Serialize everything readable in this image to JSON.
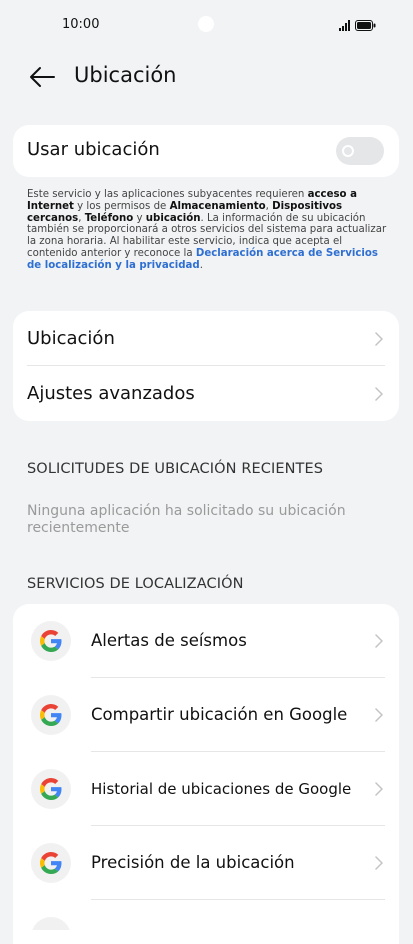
{
  "status_bar": {
    "time": "10:00"
  },
  "header": {
    "title": "Ubicación"
  },
  "use_location": {
    "label": "Usar ubicación",
    "enabled": false
  },
  "description": {
    "t1": "Este servicio y las aplicaciones subyacentes requieren ",
    "b1": "acceso a Internet",
    "t2": " y los permisos de ",
    "b2": "Almacenamiento",
    "t3": ", ",
    "b3": "Dispositivos cercanos",
    "t4": ", ",
    "b4": "Teléfono",
    "t5": " y ",
    "b5": "ubicación",
    "t6": ". La información de su ubicación también se proporcionará a otros servicios del sistema para actualizar la zona horaria. Al habilitar este servicio, indica que acepta el contenido anterior y reconoce la ",
    "link": "Declaración acerca de Servicios de localización y la privacidad",
    "t7": "."
  },
  "settings": {
    "items": [
      {
        "label": "Ubicación"
      },
      {
        "label": "Ajustes avanzados"
      }
    ]
  },
  "recent": {
    "header": "SOLICITUDES DE UBICACIÓN RECIENTES",
    "empty": "Ninguna aplicación ha solicitado su ubicación recientemente"
  },
  "services": {
    "header": "SERVICIOS DE LOCALIZACIÓN",
    "items": [
      {
        "label": "Alertas de seísmos",
        "icon": "google-icon"
      },
      {
        "label": "Compartir ubicación en Google",
        "icon": "google-icon"
      },
      {
        "label": "Historial de ubicaciones de Google",
        "icon": "google-icon"
      },
      {
        "label": "Precisión de la ubicación",
        "icon": "google-icon"
      }
    ]
  },
  "colors": {
    "background": "#f1f3f5",
    "card": "#ffffff",
    "link": "#2f6fd1",
    "toggle_off": "#e4e6e8"
  }
}
